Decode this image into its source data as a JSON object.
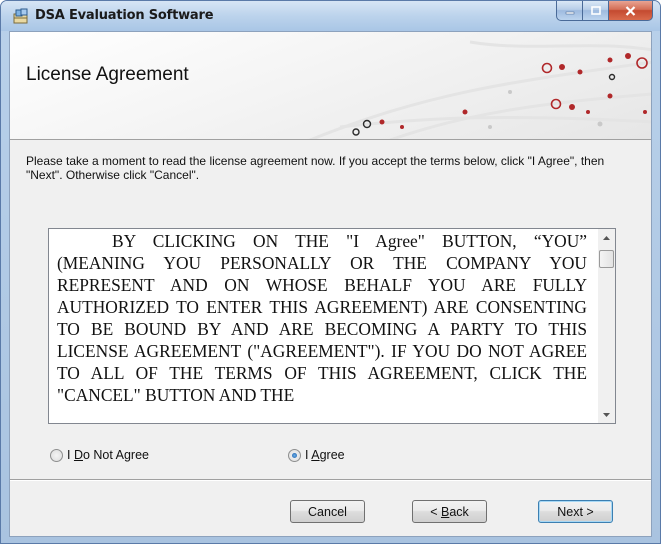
{
  "window": {
    "title": "DSA Evaluation Software",
    "title_icon": "installer-package-icon",
    "controls": [
      "minimize",
      "maximize",
      "close"
    ]
  },
  "banner": {
    "title": "License Agreement",
    "art": "circuit-dots-graphic"
  },
  "intro_text": "Please take a moment to read the license agreement now. If you accept the terms below, click \"I Agree\", then \"Next\". Otherwise click \"Cancel\".",
  "license": {
    "text": "BY CLICKING ON THE \"I Agree\" BUTTON, “YOU” (MEANING YOU PERSONALLY OR THE COMPANY YOU REPRESENT AND ON WHOSE BEHALF YOU ARE FULLY AUTHORIZED TO ENTER THIS AGREEMENT) ARE CONSENTING TO BE BOUND BY AND ARE BECOMING A PARTY TO THIS LICENSE AGREEMENT (\"AGREEMENT\"). IF YOU DO NOT AGREE TO ALL OF THE TERMS OF THIS AGREEMENT, CLICK THE \"CANCEL\" BUTTON AND THE"
  },
  "options": {
    "disagree": {
      "pre": "I ",
      "accel": "D",
      "post": "o Not Agree",
      "selected": false
    },
    "agree": {
      "pre": "I ",
      "accel": "A",
      "post": "gree",
      "selected": true
    }
  },
  "buttons": {
    "cancel": "Cancel",
    "back": "< Back",
    "next": "Next >"
  },
  "colors": {
    "title_bar": "#bcd3ec",
    "close_button": "#c44a30",
    "dialog_background": "#f0f0f0",
    "circuit_red": "#b0282a"
  }
}
